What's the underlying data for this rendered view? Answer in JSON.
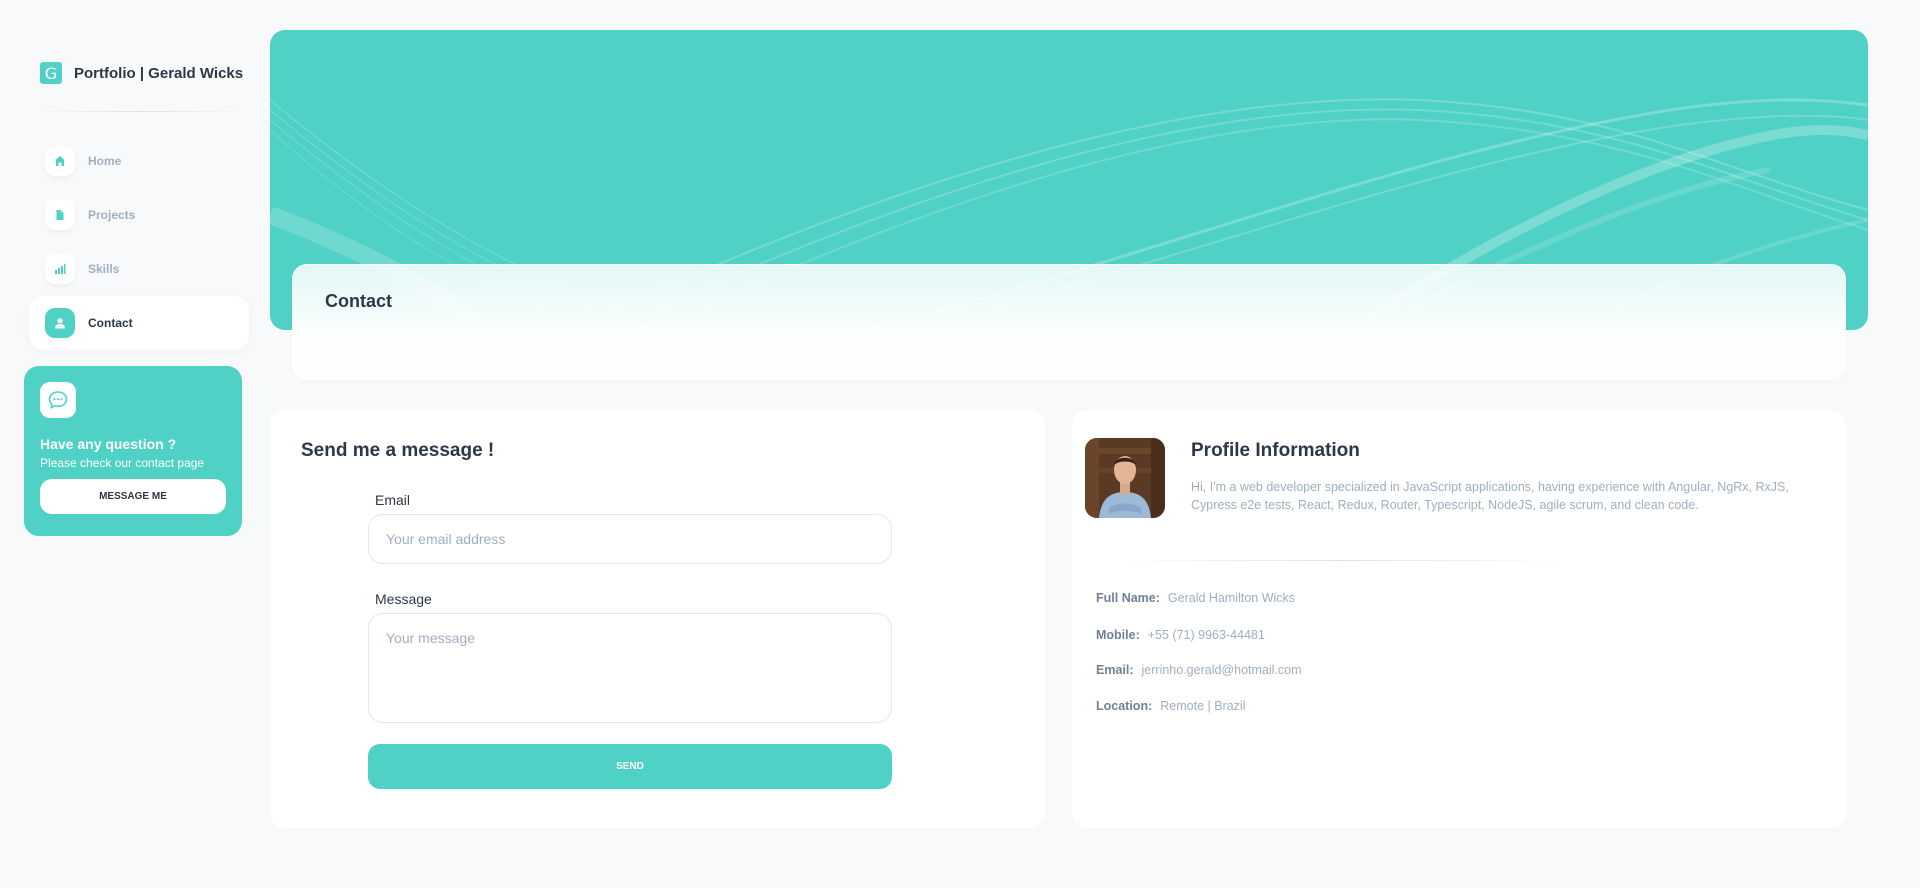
{
  "brand": {
    "logo_letter": "G",
    "title": "Portfolio | Gerald Wicks"
  },
  "nav": {
    "items": [
      {
        "label": "Home",
        "icon": "home-icon"
      },
      {
        "label": "Projects",
        "icon": "document-icon"
      },
      {
        "label": "Skills",
        "icon": "bar-chart-icon"
      },
      {
        "label": "Contact",
        "icon": "person-icon",
        "active": true
      }
    ]
  },
  "help": {
    "icon": "chat-bubble-icon",
    "title": "Have any question ?",
    "subtitle": "Please check our contact page",
    "button": "MESSAGE ME"
  },
  "header": {
    "page_title": "Contact"
  },
  "message_form": {
    "title": "Send me a message !",
    "email_label": "Email",
    "email_placeholder": "Your email address",
    "email_value": "",
    "message_label": "Message",
    "message_placeholder": "Your message",
    "message_value": "",
    "send_label": "SEND"
  },
  "profile": {
    "title": "Profile Information",
    "description": "Hi, I'm a web developer specialized in JavaScript applications, having experience with Angular, NgRx, RxJS, Cypress e2e tests, React, Redux, Router, Typescript, NodeJS, agile scrum, and clean code.",
    "fields": [
      {
        "key": "Full Name:",
        "value": "Gerald Hamilton Wicks"
      },
      {
        "key": "Mobile:",
        "value": "+55 (71) 9963-44481"
      },
      {
        "key": "Email:",
        "value": "jerrinho.gerald@hotmail.com"
      },
      {
        "key": "Location:",
        "value": "Remote | Brazil"
      }
    ]
  },
  "colors": {
    "accent": "#4fd1c5",
    "text_dark": "#2d3748",
    "text_muted": "#a0aec0",
    "background": "#f8f9fa"
  }
}
